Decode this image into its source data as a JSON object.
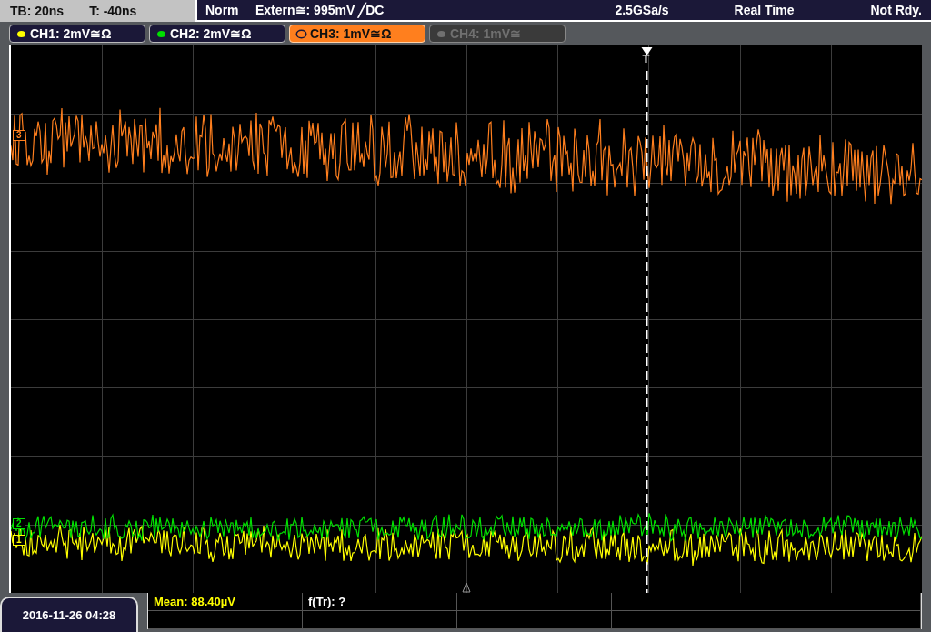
{
  "timebase": {
    "tb": "TB: 20ns",
    "t": "T: -40ns"
  },
  "trigger_bar": {
    "mode": "Norm",
    "source": "Extern≅: 995mV ╱DC",
    "rate": "2.5GSa/s",
    "acquisition": "Real Time",
    "status": "Not Rdy."
  },
  "channels": [
    {
      "label": "CH1: 2mV≅Ω",
      "color": "#ffff00",
      "selected": false,
      "enabled": true
    },
    {
      "label": "CH2: 2mV≅Ω",
      "color": "#00e000",
      "selected": false,
      "enabled": true
    },
    {
      "label": "CH3: 1mV≅Ω",
      "color": "#ff7f1e",
      "selected": true,
      "enabled": true
    },
    {
      "label": "CH4: 1mV≅",
      "color": "#707070",
      "selected": false,
      "enabled": false
    }
  ],
  "ground_markers": [
    {
      "label": "3",
      "color": "#ff7f1e"
    },
    {
      "label": "2",
      "color": "#00e000"
    },
    {
      "label": "1",
      "color": "#ffff00"
    }
  ],
  "trigger_marker": {
    "label": "T"
  },
  "datetime": "2016-11-26 04:28",
  "measurements": [
    {
      "text": "Mean: 88.40µV",
      "kind": "channel"
    },
    {
      "text": "f(Tr): ?",
      "kind": "plain"
    }
  ]
}
